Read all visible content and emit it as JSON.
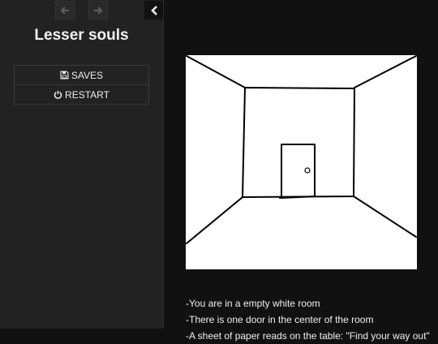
{
  "story": {
    "title": "Lesser souls"
  },
  "icons": {
    "back": "arrow-left-icon",
    "forward": "arrow-right-icon",
    "toggle": "chevron-left-icon",
    "saves": "floppy-disk-icon",
    "restart": "power-icon"
  },
  "menu": {
    "saves_label": "SAVES",
    "restart_label": "RESTART"
  },
  "passage": {
    "lines": [
      "-You are in a empty white room",
      "-There is one door in the center of the room",
      "-A sheet of paper reads on the table: \"Find your way out\""
    ]
  },
  "colors": {
    "sidebar_bg": "#222222",
    "page_bg": "#111111",
    "text": "#eeeeee"
  }
}
